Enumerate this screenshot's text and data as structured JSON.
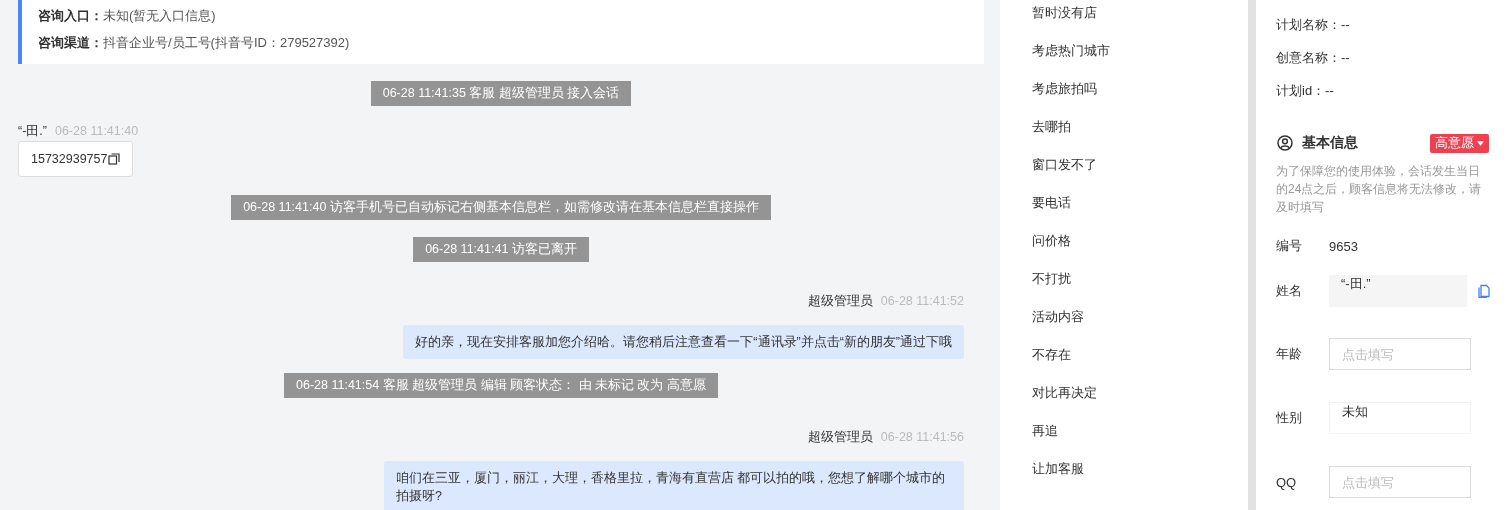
{
  "source_card": {
    "lines": [
      {
        "label": "咨询入口：",
        "value": "未知(暂无入口信息)"
      },
      {
        "label": "咨询渠道：",
        "value": "抖音企业号/员工号(抖音号ID：279527392)"
      }
    ]
  },
  "messages": [
    {
      "kind": "system",
      "text": "06-28 11:41:35 客服 超级管理员 接入会话"
    },
    {
      "kind": "visitor",
      "name": "“-田.”",
      "time": "06-28 11:41:40",
      "text": "15732939757"
    },
    {
      "kind": "system",
      "text": "06-28 11:41:40 访客手机号已自动标记右侧基本信息栏，如需修改请在基本信息栏直接操作"
    },
    {
      "kind": "system",
      "text": "06-28 11:41:41 访客已离开"
    },
    {
      "kind": "agent",
      "name": "超级管理员",
      "time": "06-28 11:41:52",
      "text": "好的亲，现在安排客服加您介绍哈。请您稍后注意查看一下“通讯录”并点击“新的朋友”通过下哦"
    },
    {
      "kind": "system",
      "text": "06-28 11:41:54 客服 超级管理员 编辑 顾客状态： 由 未标记 改为 高意愿"
    },
    {
      "kind": "agent",
      "name": "超级管理员",
      "time": "06-28 11:41:56",
      "text": "咱们在三亚，厦门，丽江，大理，香格里拉，青海有直营店 都可以拍的哦，您想了解哪个城市的拍摄呀?"
    }
  ],
  "quick_replies": [
    "暂时没有店",
    "考虑热门城市",
    "考虑旅拍吗",
    "去哪拍",
    "窗口发不了",
    "要电话",
    "问价格",
    "不打扰",
    "活动内容",
    "不存在",
    "对比再决定",
    "再追",
    "让加客服"
  ],
  "plan_info": [
    "计划名称：--",
    "创意名称：--",
    "计划id：--"
  ],
  "basic_info": {
    "title": "基本信息",
    "status_tag": "高意愿",
    "note": "为了保障您的使用体验，会话发生当日的24点之后，顾客信息将无法修改，请及时填写",
    "fields": [
      {
        "kind": "text",
        "label": "编号",
        "value": "9653"
      },
      {
        "kind": "readonly",
        "label": "姓名",
        "value": "“-田.”"
      },
      {
        "kind": "input",
        "label": "年龄",
        "placeholder": "点击填写"
      },
      {
        "kind": "select",
        "label": "性别",
        "value": "未知"
      },
      {
        "kind": "input",
        "label": "QQ",
        "placeholder": "点击填写"
      }
    ]
  }
}
